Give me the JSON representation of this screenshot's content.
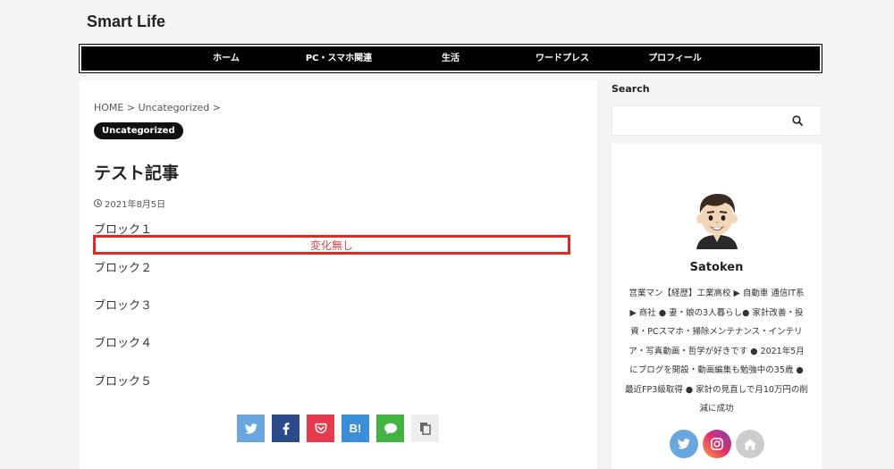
{
  "site": {
    "title": "Smart Life"
  },
  "nav": {
    "items": [
      {
        "label": "ホーム"
      },
      {
        "label": "PC・スマホ関連"
      },
      {
        "label": "生活"
      },
      {
        "label": "ワードプレス"
      },
      {
        "label": "プロフィール"
      }
    ]
  },
  "article": {
    "breadcrumb": "HOME > Uncategorized >",
    "category": "Uncategorized",
    "title": "テスト記事",
    "date": "2021年8月5日",
    "blocks": [
      "ブロック１",
      "ブロック２",
      "ブロック３",
      "ブロック４",
      "ブロック５"
    ],
    "highlight_text": "変化無し",
    "share": [
      {
        "name": "twitter",
        "color": "#6aa7e0"
      },
      {
        "name": "facebook",
        "color": "#2b4a8a"
      },
      {
        "name": "pocket",
        "color": "#e5394d"
      },
      {
        "name": "hatena",
        "label": "B!",
        "color": "#3a8fd8"
      },
      {
        "name": "line",
        "color": "#42b240"
      },
      {
        "name": "copy",
        "color": "#eeeeee"
      }
    ]
  },
  "sidebar": {
    "search_heading": "Search",
    "search_placeholder": "",
    "profile": {
      "name": "Satoken",
      "bio": "営業マン【経歴】工業高校 ▶ 自動車 通信IT系 ▶ 商社 ● 妻・娘の3人暮らし● 家計改善・投資・PCスマホ・掃除メンテナンス・インテリア・写真動画・哲学が好きです ● 2021年5月にブログを開設・動画編集も勉強中の35歳 ● 最近FP3級取得 ● 家計の見直しで月10万円の削減に成功",
      "social": [
        {
          "name": "twitter",
          "color": "#6aa7e0"
        },
        {
          "name": "instagram",
          "color": "#c13584"
        },
        {
          "name": "home",
          "color": "#cccccc"
        }
      ]
    }
  }
}
